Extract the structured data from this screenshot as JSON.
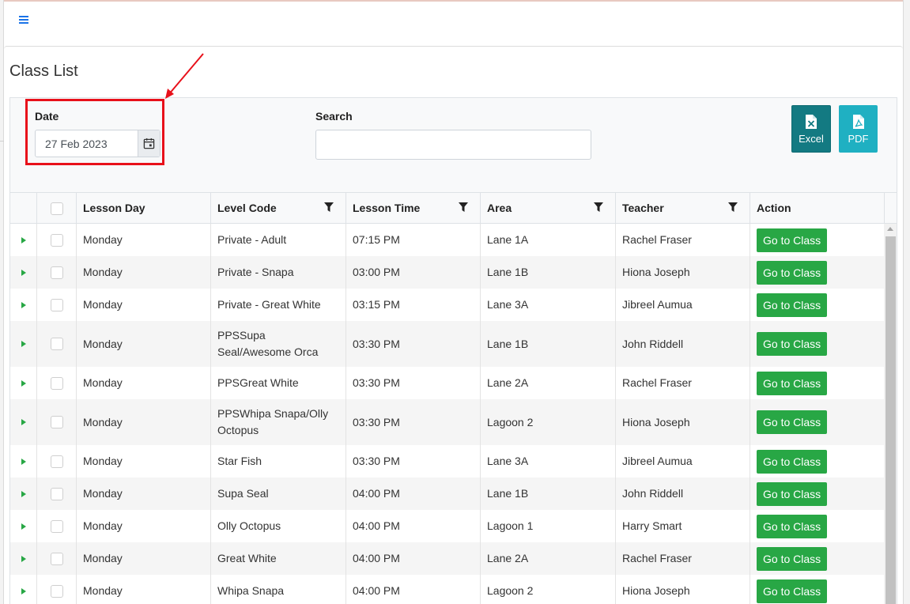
{
  "page": {
    "title": "Class List"
  },
  "filters": {
    "date_label": "Date",
    "date_value": "27 Feb 2023",
    "search_label": "Search",
    "search_value": ""
  },
  "exports": {
    "excel_label": "Excel",
    "pdf_label": "PDF"
  },
  "table": {
    "columns": [
      "Lesson Day",
      "Level Code",
      "Lesson Time",
      "Area",
      "Teacher",
      "Action"
    ],
    "rows": [
      [
        "Monday",
        "Private - Adult",
        "07:15 PM",
        "Lane 1A",
        "Rachel Fraser",
        "Go to Class"
      ],
      [
        "Monday",
        "Private - Snapa",
        "03:00 PM",
        "Lane 1B",
        "Hiona Joseph",
        "Go to Class"
      ],
      [
        "Monday",
        "Private - Great White",
        "03:15 PM",
        "Lane 3A",
        "Jibreel Aumua",
        "Go to Class"
      ],
      [
        "Monday",
        "PPSSupa Seal/Awesome Orca",
        "03:30 PM",
        "Lane 1B",
        "John Riddell",
        "Go to Class"
      ],
      [
        "Monday",
        "PPSGreat White",
        "03:30 PM",
        "Lane 2A",
        "Rachel Fraser",
        "Go to Class"
      ],
      [
        "Monday",
        "PPSWhipa Snapa/Olly Octopus",
        "03:30 PM",
        "Lagoon 2",
        "Hiona Joseph",
        "Go to Class"
      ],
      [
        "Monday",
        "Star Fish",
        "03:30 PM",
        "Lane 3A",
        "Jibreel Aumua",
        "Go to Class"
      ],
      [
        "Monday",
        "Supa Seal",
        "04:00 PM",
        "Lane 1B",
        "John Riddell",
        "Go to Class"
      ],
      [
        "Monday",
        "Olly Octopus",
        "04:00 PM",
        "Lagoon 1",
        "Harry Smart",
        "Go to Class"
      ],
      [
        "Monday",
        "Great White",
        "04:00 PM",
        "Lane 2A",
        "Rachel Fraser",
        "Go to Class"
      ],
      [
        "Monday",
        "Whipa Snapa",
        "04:00 PM",
        "Lagoon 2",
        "Hiona Joseph",
        "Go to Class"
      ]
    ]
  },
  "colors": {
    "action_button": "#28a745",
    "excel_button": "#137a82",
    "pdf_button": "#1fb0c2",
    "annotation": "#e8101a",
    "expander": "#28a745"
  },
  "icons": {
    "menu": "hamburger-icon",
    "calendar": "calendar-icon",
    "excel": "excel-file-icon",
    "pdf": "pdf-file-icon",
    "filter": "filter-icon",
    "expand": "expand-arrow-icon"
  }
}
